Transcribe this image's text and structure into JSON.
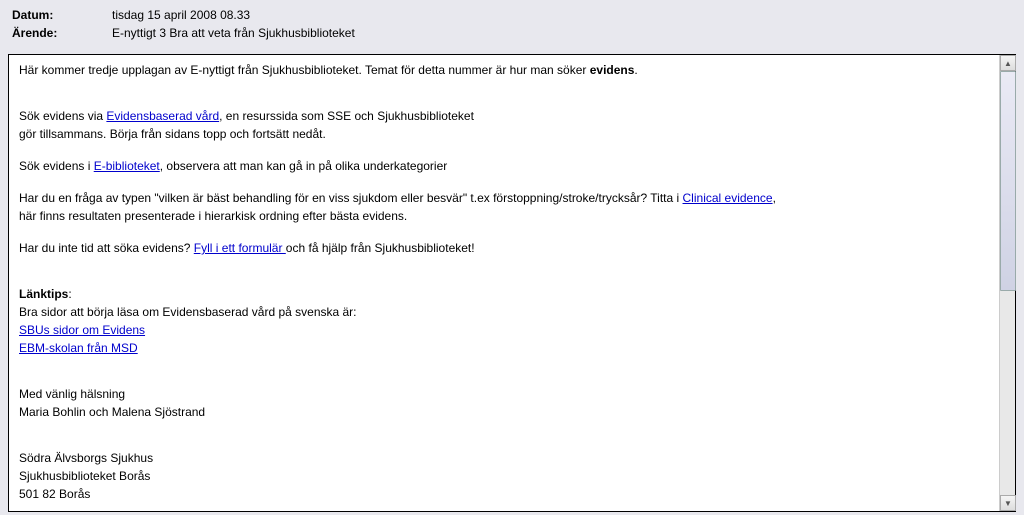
{
  "header": {
    "datum_label": "Datum:",
    "datum_value": "tisdag 15 april 2008 08.33",
    "arende_label": "Ärende:",
    "arende_value": "E-nyttigt 3 Bra att veta från Sjukhusbiblioteket"
  },
  "body": {
    "intro_pre": "Här kommer tredje upplagan av E-nyttigt från Sjukhusbiblioteket. Temat för detta nummer är hur man söker ",
    "intro_bold": "evidens",
    "intro_post": ".",
    "p2_pre": "Sök evidens via ",
    "p2_link": "Evidensbaserad vård",
    "p2_post1": ", en resurssida som SSE och Sjukhusbiblioteket",
    "p2_line2": "gör tillsammans. Börja från sidans topp och fortsätt nedåt.",
    "p3_pre": "Sök evidens i ",
    "p3_link": "E-biblioteket",
    "p3_post": ", observera att man kan gå in på olika underkategorier",
    "p4_pre": "Har du en fråga av typen \"vilken är bäst behandling för en viss sjukdom eller besvär\" t.ex förstoppning/stroke/trycksår? Titta i ",
    "p4_link": "Clinical evidence",
    "p4_post": ",",
    "p4_line2": "här finns resultaten presenterade i hierarkisk ordning efter bästa evidens.",
    "p5_pre": "Har du inte tid att söka evidens? ",
    "p5_link": "Fyll i ett formulär ",
    "p5_post": "och få hjälp från Sjukhusbiblioteket!",
    "linktips_label": "Länktips",
    "linktips_colon": ":",
    "linktips_intro": "Bra sidor att börja läsa om Evidensbaserad vård på svenska är:",
    "link_sbu": "SBUs sidor om Evidens",
    "link_ebm": "EBM-skolan från MSD",
    "sign_greeting": "Med vänlig hälsning",
    "sign_names": "Maria Bohlin och Malena Sjöstrand",
    "addr1": "Södra Älvsborgs Sjukhus",
    "addr2": "Sjukhusbiblioteket Borås",
    "addr3": "501 82 Borås"
  }
}
